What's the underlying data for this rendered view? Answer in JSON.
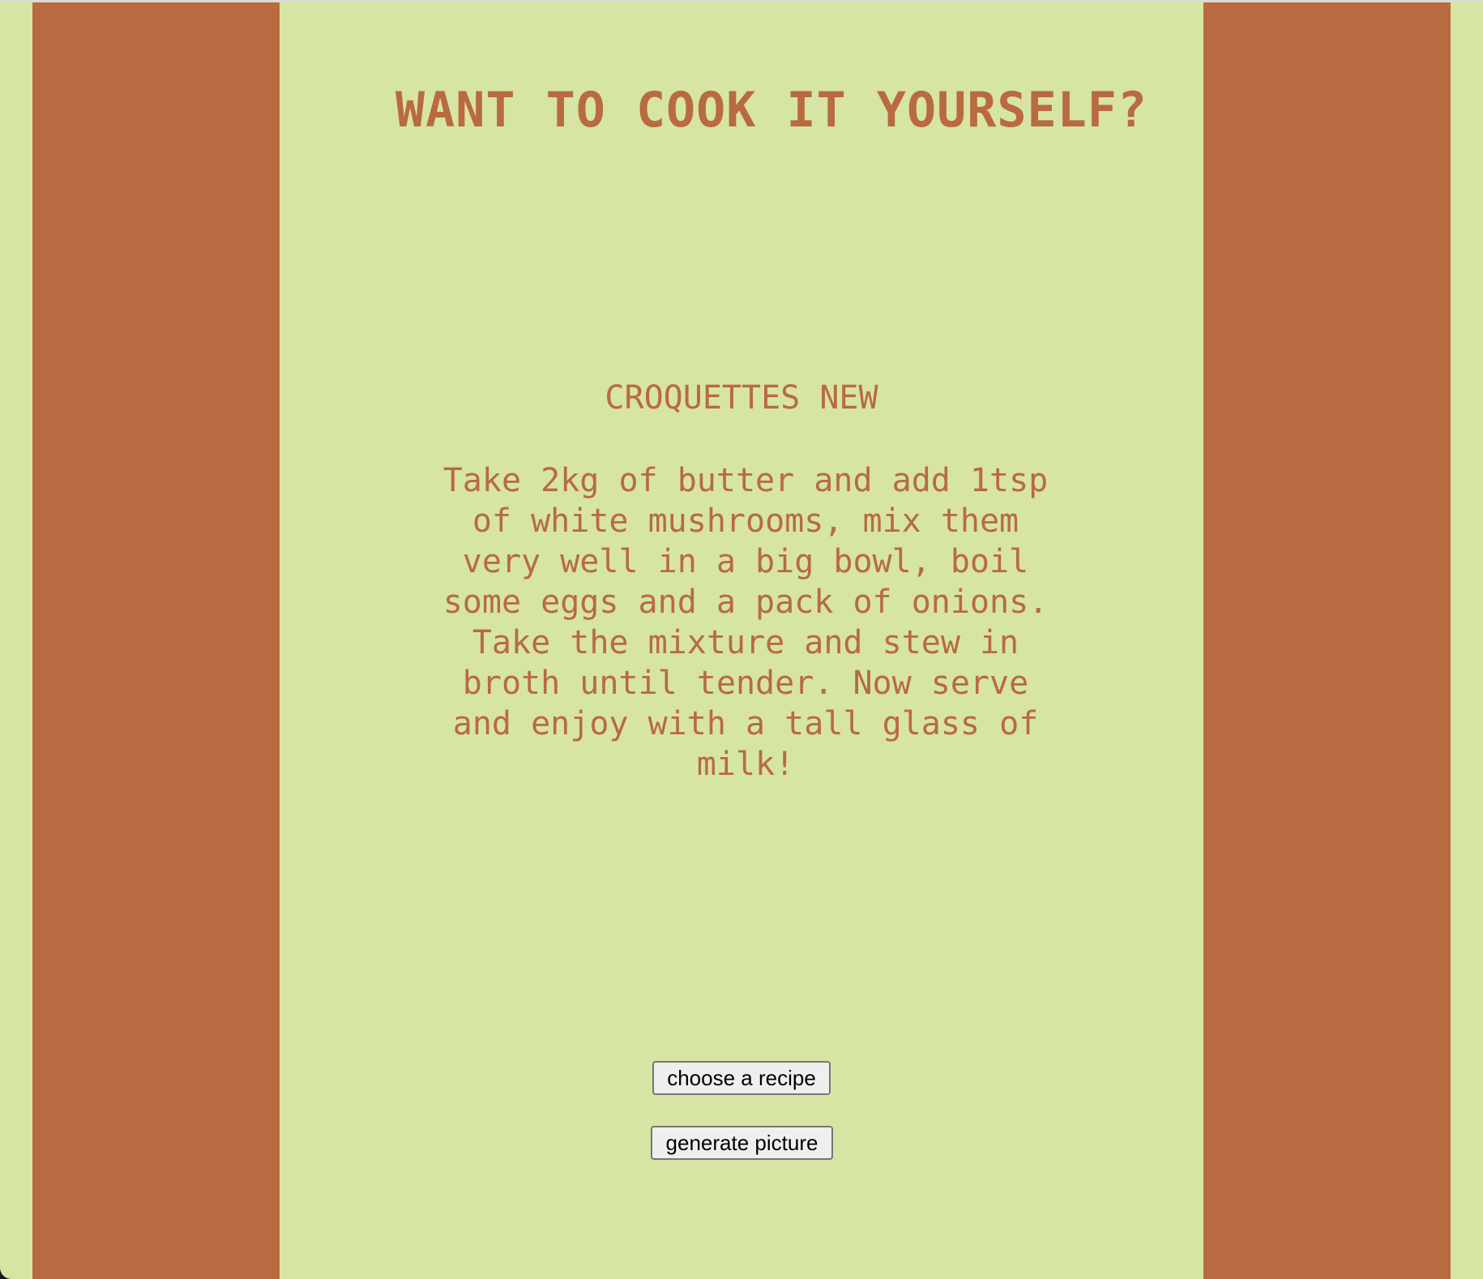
{
  "header": {
    "title": "WANT TO COOK IT YOURSELF?"
  },
  "recipe": {
    "name": "CROQUETTES NEW",
    "instructions": "Take 2kg of butter and add 1tsp of white mushrooms, mix them very well in a big bowl, boil some eggs and a pack of onions. Take the mixture and stew in broth until tender. Now serve and enjoy with a tall glass of milk!"
  },
  "actions": {
    "choose_label": "choose a recipe",
    "generate_label": "generate picture"
  },
  "colors": {
    "background": "#d6e5a3",
    "accent": "#b96a40"
  }
}
